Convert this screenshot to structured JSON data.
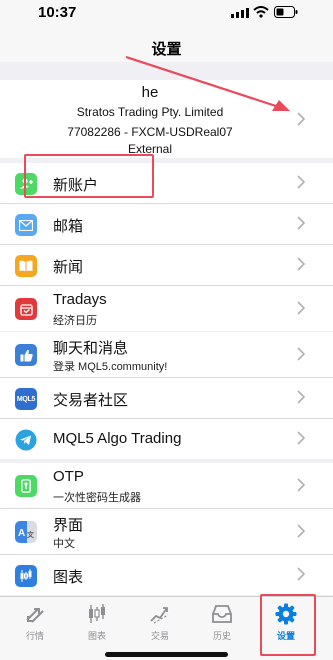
{
  "status": {
    "time": "10:37"
  },
  "nav": {
    "title": "设置"
  },
  "account": {
    "name": "he",
    "company": "Stratos Trading Pty. Limited",
    "number": "77082286 - FXCM-USDReal07",
    "type": "External"
  },
  "group1": [
    {
      "label": "新账户",
      "icon": "new-account-icon",
      "color": "#4cd964"
    },
    {
      "label": "邮箱",
      "icon": "mail-icon",
      "color": "#5aa9f0"
    },
    {
      "label": "新闻",
      "icon": "book-icon",
      "color": "#f5a623"
    },
    {
      "label": "Tradays",
      "sub": "经济日历",
      "icon": "calendar-icon",
      "color": "#e03a3a"
    }
  ],
  "group2": [
    {
      "label": "聊天和消息",
      "sub": "登录 MQL5.community!",
      "icon": "thumbs-up-icon",
      "color": "#3b7fd6"
    },
    {
      "label": "交易者社区",
      "icon": "mql5-icon",
      "color": "#2f6fd0"
    },
    {
      "label": "MQL5 Algo Trading",
      "icon": "telegram-icon",
      "color": "#2aa3e0"
    }
  ],
  "group3": [
    {
      "label": "OTP",
      "sub": "一次性密码生成器",
      "icon": "key-icon",
      "color": "#4cd964"
    },
    {
      "label": "界面",
      "sub": "中文",
      "icon": "language-icon",
      "color": "#3b86e5"
    },
    {
      "label": "图表",
      "icon": "chart-icon",
      "color": "#2e7fe0"
    }
  ],
  "tabs": [
    {
      "label": "行情",
      "icon": "quotes-icon"
    },
    {
      "label": "图表",
      "icon": "candles-icon"
    },
    {
      "label": "交易",
      "icon": "trade-icon"
    },
    {
      "label": "历史",
      "icon": "history-icon"
    },
    {
      "label": "设置",
      "icon": "settings-gear-icon",
      "active": true
    }
  ],
  "colors": {
    "accent": "#0a7fe0",
    "annotation": "#e94a5c",
    "inactive": "#8e8e93"
  }
}
